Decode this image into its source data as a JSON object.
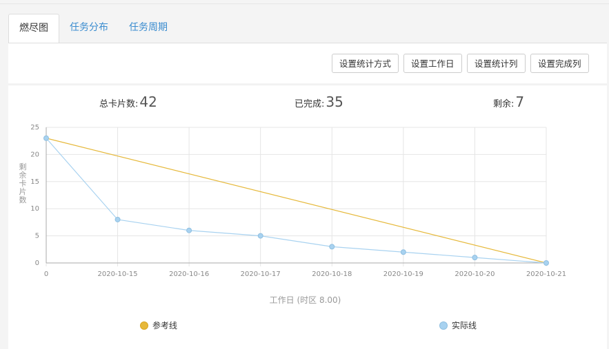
{
  "tabs": [
    {
      "label": "燃尽图",
      "active": true
    },
    {
      "label": "任务分布",
      "active": false
    },
    {
      "label": "任务周期",
      "active": false
    }
  ],
  "toolbar": {
    "buttons": [
      "设置统计方式",
      "设置工作日",
      "设置统计列",
      "设置完成列"
    ]
  },
  "stats": {
    "total_label": "总卡片数:",
    "total_value": "42",
    "done_label": "已完成:",
    "done_value": "35",
    "remain_label": "剩余:",
    "remain_value": "7"
  },
  "colors": {
    "reference": "#e6b83a",
    "actual": "#a8d2f0",
    "actual_point": "#a8d2f0",
    "link": "#3a8ccf"
  },
  "chart_data": {
    "type": "line",
    "categories": [
      "0",
      "2020-10-15",
      "2020-10-16",
      "2020-10-17",
      "2020-10-18",
      "2020-10-19",
      "2020-10-20",
      "2020-10-21"
    ],
    "series": [
      {
        "name": "参考线",
        "values": [
          23,
          null,
          null,
          null,
          null,
          null,
          null,
          0
        ]
      },
      {
        "name": "实际线",
        "values": [
          23,
          8,
          6,
          5,
          3,
          2,
          1,
          0
        ]
      }
    ],
    "xlabel": "工作日 (时区 8.00)",
    "ylabel": "剩余卡片数",
    "ylim": [
      0,
      25
    ],
    "yticks": [
      "0",
      "5",
      "10",
      "15",
      "20",
      "25"
    ],
    "grid": true,
    "legend_position": "bottom"
  }
}
